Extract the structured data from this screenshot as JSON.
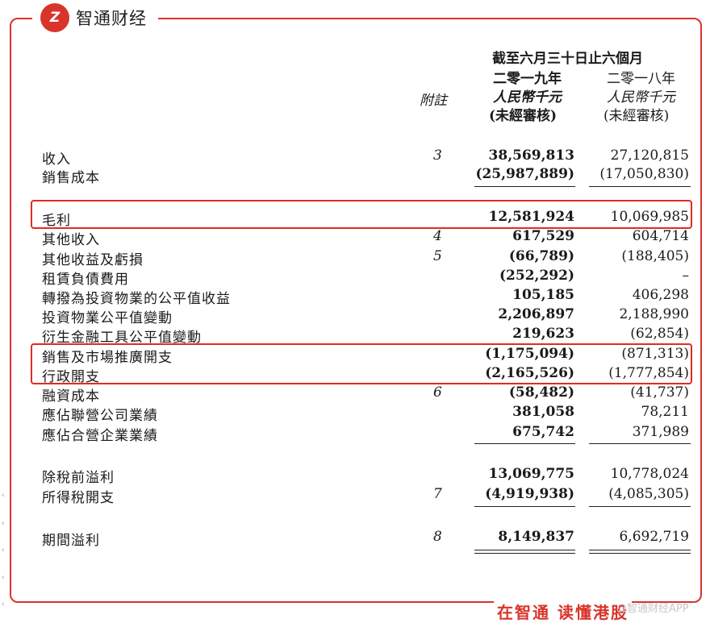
{
  "brand": {
    "logo_glyph": "Z",
    "name": "智通财经"
  },
  "header": {
    "period": "截至六月三十日止六個月",
    "note_col": "附註",
    "col_current": {
      "year": "二零一九年",
      "currency": "人民幣千元",
      "audit": "(未經審核)"
    },
    "col_prior": {
      "year": "二零一八年",
      "currency": "人民幣千元",
      "audit": "(未經審核)"
    }
  },
  "rows": [
    {
      "label": "收入",
      "note": "3",
      "current": "38,569,813",
      "prior": "27,120,815"
    },
    {
      "label": "銷售成本",
      "note": "",
      "current": "(25,987,889)",
      "prior": "(17,050,830)"
    },
    {
      "label": "毛利",
      "note": "",
      "current": "12,581,924",
      "prior": "10,069,985"
    },
    {
      "label": "其他收入",
      "note": "4",
      "current": "617,529",
      "prior": "604,714"
    },
    {
      "label": "其他收益及虧損",
      "note": "5",
      "current": "(66,789)",
      "prior": "(188,405)"
    },
    {
      "label": "租賃負債費用",
      "note": "",
      "current": "(252,292)",
      "prior": "–"
    },
    {
      "label": "轉撥為投資物業的公平值收益",
      "note": "",
      "current": "105,185",
      "prior": "406,298"
    },
    {
      "label": "投資物業公平值變動",
      "note": "",
      "current": "2,206,897",
      "prior": "2,188,990"
    },
    {
      "label": "衍生金融工具公平值變動",
      "note": "",
      "current": "219,623",
      "prior": "(62,854)"
    },
    {
      "label": "銷售及市場推廣開支",
      "note": "",
      "current": "(1,175,094)",
      "prior": "(871,313)"
    },
    {
      "label": "行政開支",
      "note": "",
      "current": "(2,165,526)",
      "prior": "(1,777,854)"
    },
    {
      "label": "融資成本",
      "note": "6",
      "current": "(58,482)",
      "prior": "(41,737)"
    },
    {
      "label": "應佔聯營公司業績",
      "note": "",
      "current": "381,058",
      "prior": "78,211"
    },
    {
      "label": "應佔合營企業業績",
      "note": "",
      "current": "675,742",
      "prior": "371,989"
    },
    {
      "label": "除稅前溢利",
      "note": "",
      "current": "13,069,775",
      "prior": "10,778,024"
    },
    {
      "label": "所得稅開支",
      "note": "7",
      "current": "(4,919,938)",
      "prior": "(4,085,305)"
    },
    {
      "label": "期間溢利",
      "note": "8",
      "current": "8,149,837",
      "prior": "6,692,719"
    }
  ],
  "footer": {
    "slogan": "在智通 读懂港股",
    "watermark": "@智通财经APP"
  },
  "colors": {
    "brand_red": "#d9342b",
    "highlight_red": "#e02b22"
  }
}
